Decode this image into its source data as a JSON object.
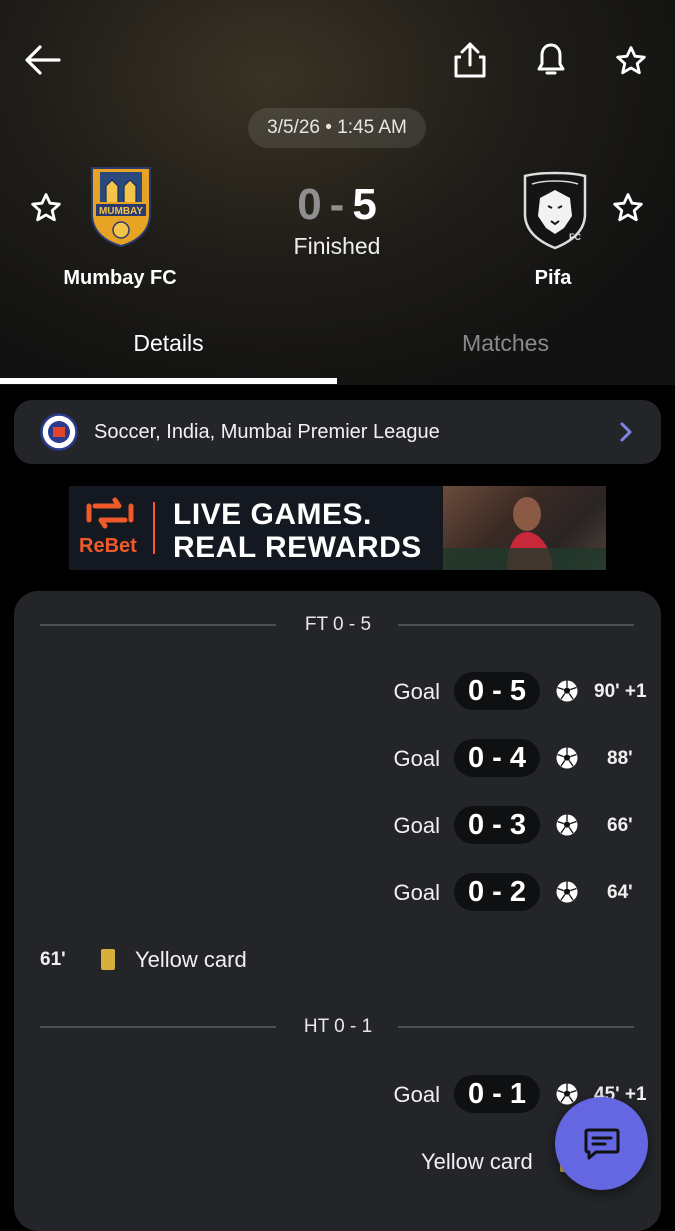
{
  "match": {
    "date_time": "3/5/26 • 1:45 AM",
    "home_team": "Mumbay FC",
    "away_team": "Pifa",
    "home_score": "0",
    "away_score": "5",
    "score_separator": "-",
    "status": "Finished",
    "home_crest_text": "MUMBAY",
    "away_crest_text": "FC"
  },
  "tabs": {
    "details": "Details",
    "matches": "Matches",
    "active": "Details"
  },
  "league": {
    "text": "Soccer, India, Mumbai Premier League"
  },
  "ad": {
    "brand": "ReBet",
    "line1": "LIVE GAMES.",
    "line2": "REAL REWARDS"
  },
  "events": {
    "full_time_label": "FT 0 - 5",
    "half_time_label": "HT 0 - 1",
    "items": [
      {
        "type": "Goal",
        "score": "0 - 5",
        "minute": "90' +1"
      },
      {
        "type": "Goal",
        "score": "0 - 4",
        "minute": "88'"
      },
      {
        "type": "Goal",
        "score": "0 - 3",
        "minute": "66'"
      },
      {
        "type": "Goal",
        "score": "0 - 2",
        "minute": "64'"
      },
      {
        "type": "Yellow card",
        "minute": "61'",
        "side": "home"
      },
      {
        "type": "Goal",
        "score": "0 - 1",
        "minute": "45' +1"
      },
      {
        "type": "Yellow card",
        "side": "away"
      }
    ]
  },
  "icons": {
    "back": "arrow-left-icon",
    "share": "share-icon",
    "notifications": "bell-icon",
    "favorite": "star-icon",
    "chevron": "chevron-right-icon",
    "goal": "soccer-ball-icon",
    "chat": "chat-icon"
  },
  "colors": {
    "accent": "#6466e2",
    "chevron": "#7b86e8",
    "card_background": "#232529",
    "yellow_card": "#d4af3c",
    "ad_brand": "#f05a28"
  }
}
